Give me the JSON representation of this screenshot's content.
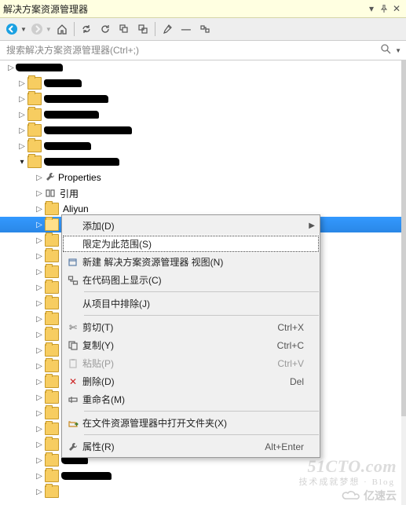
{
  "title": "解决方案资源管理器",
  "search": {
    "placeholder": "搜索解决方案资源管理器(Ctrl+;)"
  },
  "toolbar": {
    "back": "back",
    "fwd": "forward",
    "home": "home",
    "sync": "sync",
    "refresh": "refresh",
    "collapse": "collapse",
    "showall": "show-all",
    "props": "properties",
    "preview": "preview"
  },
  "tree": {
    "properties_label": "Properties",
    "references_label": "引用",
    "aliyun_label": "Aliyun"
  },
  "context_menu": [
    {
      "label": "添加(D)",
      "icon": "",
      "submenu": true
    },
    {
      "label": "限定为此范围(S)",
      "icon": "",
      "focused": true
    },
    {
      "label": "新建 解决方案资源管理器 视图(N)",
      "icon": "new-view"
    },
    {
      "label": "在代码图上显示(C)",
      "icon": "code-map"
    },
    {
      "sep": true
    },
    {
      "label": "从项目中排除(J)",
      "icon": ""
    },
    {
      "sep": true
    },
    {
      "label": "剪切(T)",
      "icon": "cut",
      "shortcut": "Ctrl+X"
    },
    {
      "label": "复制(Y)",
      "icon": "copy",
      "shortcut": "Ctrl+C"
    },
    {
      "label": "粘贴(P)",
      "icon": "paste",
      "shortcut": "Ctrl+V",
      "disabled": true
    },
    {
      "label": "删除(D)",
      "icon": "delete",
      "shortcut": "Del"
    },
    {
      "label": "重命名(M)",
      "icon": "rename"
    },
    {
      "sep": true
    },
    {
      "label": "在文件资源管理器中打开文件夹(X)",
      "icon": "open-folder"
    },
    {
      "sep": true
    },
    {
      "label": "属性(R)",
      "icon": "properties",
      "shortcut": "Alt+Enter"
    }
  ],
  "watermark": {
    "top": "51CTO.com",
    "sub": "技术成就梦想 · Blog",
    "bottom": "亿速云"
  }
}
